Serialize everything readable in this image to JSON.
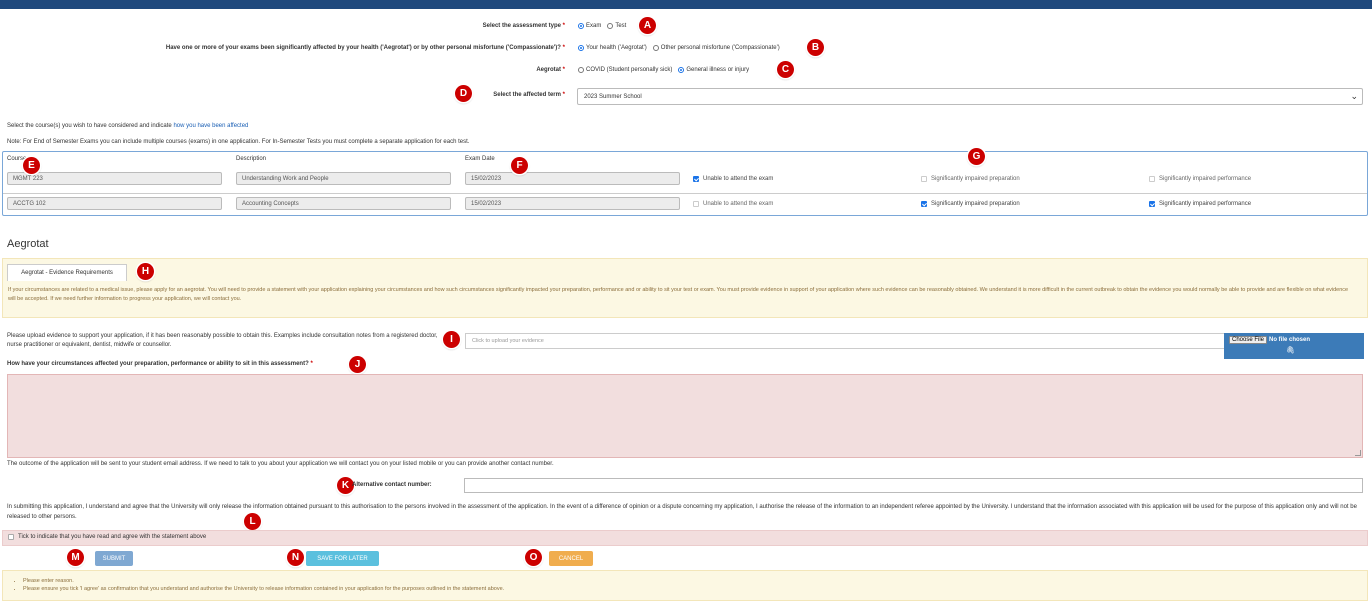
{
  "assessment_type": {
    "label": "Select the assessment type",
    "required_mark": "*",
    "options": [
      "Exam",
      "Test"
    ],
    "selected": "Exam"
  },
  "affected_by": {
    "label": "Have one or more of your exams been significantly affected by your health ('Aegrotat') or by other personal misfortune ('Compassionate')?",
    "required_mark": "*",
    "options": [
      "Your health ('Aegrotat')",
      "Other personal misfortune ('Compassionate')"
    ],
    "selected": "Your health ('Aegrotat')"
  },
  "aegrotat_type": {
    "label": "Aegrotat",
    "required_mark": "*",
    "options": [
      "COVID (Student personally sick)",
      "General illness or injury"
    ],
    "selected": "General illness or injury"
  },
  "term": {
    "label": "Select the affected term",
    "required_mark": "*",
    "value": "2023 Summer School"
  },
  "instructions": {
    "line1_prefix": "Select the course(s) you wish to have considered and indicate",
    "line1_link": "how you have been affected",
    "line2": "Note: For End of Semester Exams you can include multiple courses (exams) in one application. For In-Semester Tests you must complete a separate application for each test."
  },
  "course_table": {
    "headers": [
      "Course",
      "Description",
      "Exam Date"
    ],
    "impact_options": [
      "Unable to attend the exam",
      "Significantly impaired preparation",
      "Significantly impaired performance"
    ],
    "rows": [
      {
        "course": "MGMT 223",
        "description": "Understanding Work and People",
        "date": "15/02/2023",
        "checked": [
          true,
          false,
          false
        ]
      },
      {
        "course": "ACCTG 102",
        "description": "Accounting Concepts",
        "date": "15/02/2023",
        "checked": [
          false,
          true,
          true
        ]
      }
    ]
  },
  "section_title": "Aegrotat",
  "evidence": {
    "tab_label": "Aegrotat - Evidence Requirements",
    "text": "If your circumstances are related to a medical issue, please apply for an aegrotat. You will need to provide a statement with your application explaining your circumstances and how such circumstances significantly impacted your preparation, performance and or ability to sit your test or exam. You must provide evidence in support of your application where such evidence can be reasonably obtained. We understand it is more difficult in the current outbreak to obtain the evidence you would normally be able to provide and are flexible on what evidence will be accepted. If we need further information to progress your application, we will contact you."
  },
  "upload": {
    "label": "Please upload evidence to support your application, if it has been reasonably possible to obtain this. Examples include consultation notes from a registered doctor, nurse practitioner or equivalent, dentist, midwife or counsellor.",
    "placeholder": "Click to upload your evidence",
    "choose_label": "Choose File",
    "no_file_label": "No file chosen"
  },
  "reason": {
    "label": "How have your circumstances affected your preparation, performance or ability to sit in this assessment?",
    "required_mark": "*",
    "value": ""
  },
  "outcome_text": "The outcome of the application will be sent to your student email address. If we need to talk to you about your application we will contact you on your listed mobile or you can provide another contact number.",
  "alt_contact": {
    "label": "Alternative contact number:",
    "value": ""
  },
  "statement": "In submitting this application, I understand and agree that the University will only release the information obtained pursuant to this authorisation to the persons involved in the assessment of the application. In the event of a difference of opinion or a dispute concerning my application, I authorise the release of the information to an independent referee appointed by the University. I understand that the information associated with this application will be used for the purpose of this application only and will not be released to other persons.",
  "agree_label": "Tick to indicate that you have read and agree with the statement above",
  "buttons": {
    "submit": "SUBMIT",
    "save": "SAVE FOR LATER",
    "cancel": "CANCEL"
  },
  "errors": [
    "Please enter reason.",
    "Please ensure you tick 'I agree' as confirmation that you understand and authorise the University to release information contained in your application for the purposes outlined in the statement above."
  ],
  "markers": [
    "A",
    "B",
    "C",
    "D",
    "E",
    "F",
    "G",
    "H",
    "I",
    "J",
    "K",
    "L",
    "M",
    "N",
    "O"
  ],
  "colors": {
    "header_bar": "#1f497d",
    "marker": "#cc0000",
    "required": "#cc0000",
    "error_panel": "#fcf8e3",
    "invalid_field": "#f2dede",
    "submit": "#7fa8d2",
    "save": "#5bc0de",
    "cancel": "#f0ad4e",
    "file_button": "#3c7bb8"
  }
}
